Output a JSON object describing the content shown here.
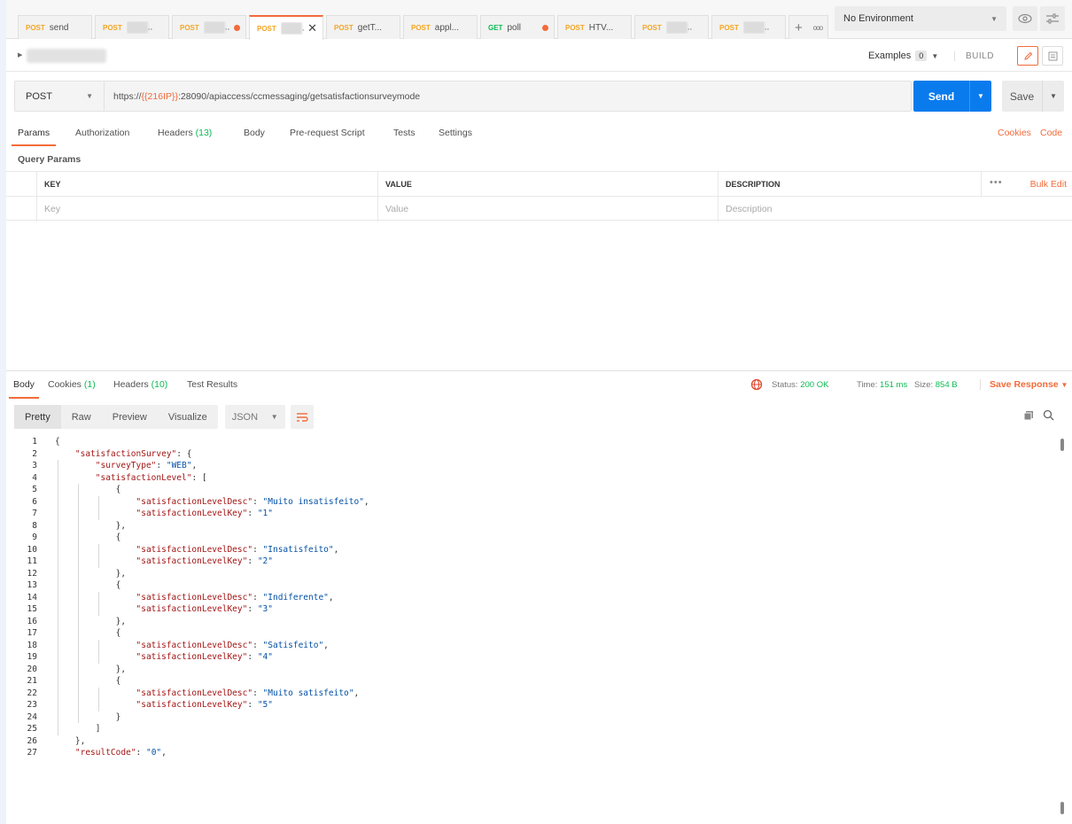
{
  "tabs": [
    {
      "method": "POST",
      "name": "send",
      "blurred": false,
      "dirty": false,
      "active": false
    },
    {
      "method": "POST",
      "name": "",
      "blurred": true,
      "dirty": false,
      "active": false
    },
    {
      "method": "POST",
      "name": "",
      "blurred": true,
      "dirty": true,
      "active": false
    },
    {
      "method": "POST",
      "name": "",
      "blurred": true,
      "dirty": false,
      "active": true
    },
    {
      "method": "POST",
      "name": "getT...",
      "blurred": false,
      "dirty": false,
      "active": false
    },
    {
      "method": "POST",
      "name": "appl...",
      "blurred": false,
      "dirty": false,
      "active": false
    },
    {
      "method": "GET",
      "name": "poll",
      "blurred": false,
      "dirty": true,
      "active": false
    },
    {
      "method": "POST",
      "name": "HTV...",
      "blurred": false,
      "dirty": false,
      "active": false
    },
    {
      "method": "POST",
      "name": "",
      "blurred": true,
      "dirty": false,
      "active": false
    },
    {
      "method": "POST",
      "name": "",
      "blurred": true,
      "dirty": false,
      "active": false
    }
  ],
  "environment": {
    "selected": "No Environment"
  },
  "name_row": {
    "examples_label": "Examples",
    "examples_count": "0",
    "build_label": "BUILD"
  },
  "request": {
    "method": "POST",
    "url_prefix": "https://",
    "url_var": "{{216IP}}",
    "url_rest": ":28090/apiaccess/ccmessaging/getsatisfactionsurveymode",
    "send_label": "Send",
    "save_label": "Save"
  },
  "request_tabs": {
    "params": "Params",
    "authorization": "Authorization",
    "headers": "Headers",
    "headers_count": "(13)",
    "body": "Body",
    "prerequest": "Pre-request Script",
    "tests": "Tests",
    "settings": "Settings",
    "cookies": "Cookies",
    "code": "Code"
  },
  "query_params": {
    "title": "Query Params",
    "columns": [
      "KEY",
      "VALUE",
      "DESCRIPTION"
    ],
    "placeholders": [
      "Key",
      "Value",
      "Description"
    ],
    "bulk_edit": "Bulk Edit"
  },
  "response_tabs": {
    "body": "Body",
    "cookies": "Cookies",
    "cookies_count": "(1)",
    "headers": "Headers",
    "headers_count": "(10)",
    "test_results": "Test Results"
  },
  "response_status": {
    "status_label": "Status:",
    "status_value": "200 OK",
    "time_label": "Time:",
    "time_value": "151 ms",
    "size_label": "Size:",
    "size_value": "854 B",
    "save_response": "Save Response"
  },
  "view_modes": [
    "Pretty",
    "Raw",
    "Preview",
    "Visualize"
  ],
  "format": "JSON",
  "code_lines": [
    "{",
    "    \"satisfactionSurvey\": {",
    "        \"surveyType\": \"WEB\",",
    "        \"satisfactionLevel\": [",
    "            {",
    "                \"satisfactionLevelDesc\": \"Muito insatisfeito\",",
    "                \"satisfactionLevelKey\": \"1\"",
    "            },",
    "            {",
    "                \"satisfactionLevelDesc\": \"Insatisfeito\",",
    "                \"satisfactionLevelKey\": \"2\"",
    "            },",
    "            {",
    "                \"satisfactionLevelDesc\": \"Indiferente\",",
    "                \"satisfactionLevelKey\": \"3\"",
    "            },",
    "            {",
    "                \"satisfactionLevelDesc\": \"Satisfeito\",",
    "                \"satisfactionLevelKey\": \"4\"",
    "            },",
    "            {",
    "                \"satisfactionLevelDesc\": \"Muito satisfeito\",",
    "                \"satisfactionLevelKey\": \"5\"",
    "            }",
    "        ]",
    "    },",
    "    \"resultCode\": \"0\","
  ],
  "colors": {
    "accent": "#f26b3a",
    "send": "#097bed",
    "post": "#f5a623",
    "get": "#0cbb52",
    "json_key": "#a31515",
    "json_string": "#0451a5"
  }
}
